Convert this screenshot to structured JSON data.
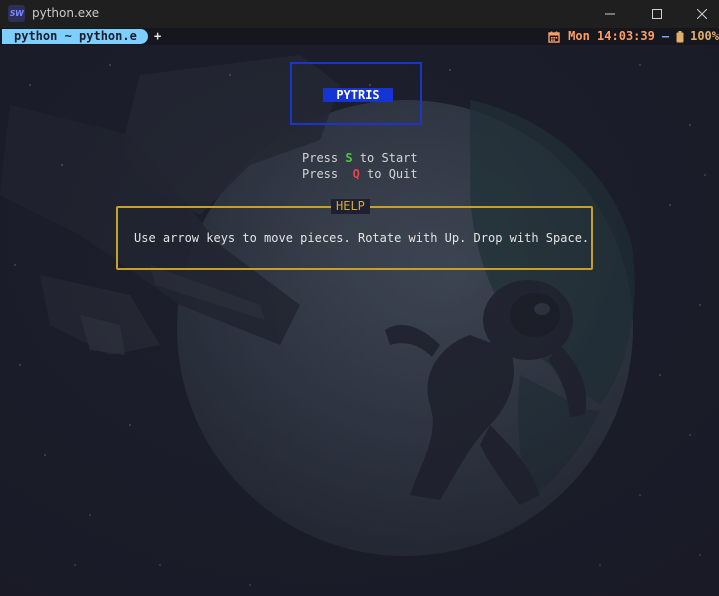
{
  "window": {
    "title": "python.exe",
    "app_icon_text": "SW"
  },
  "statusbar": {
    "tab_label": "python ~ python.e",
    "add_tab_label": "+",
    "clock": "Mon 14:03:39",
    "separator": "—",
    "battery": "100%"
  },
  "game": {
    "title": "PYTRIS",
    "start_line": {
      "prefix": "Press ",
      "key": "S",
      "suffix": " to Start"
    },
    "quit_line": {
      "prefix": "Press  ",
      "key": "Q",
      "suffix": " to Quit"
    },
    "help_title": "HELP",
    "help_text": "Use arrow keys to move pieces. Rotate with Up. Drop with Space."
  },
  "colors": {
    "background": "#1b1d29",
    "tab_active": "#7dcfff",
    "clock": "#ff9e64",
    "title_border": "#1b35c9",
    "title_fill": "#1434d4",
    "key_start": "#4ec942",
    "key_quit": "#e5414e",
    "help_border": "#c6a02a"
  }
}
